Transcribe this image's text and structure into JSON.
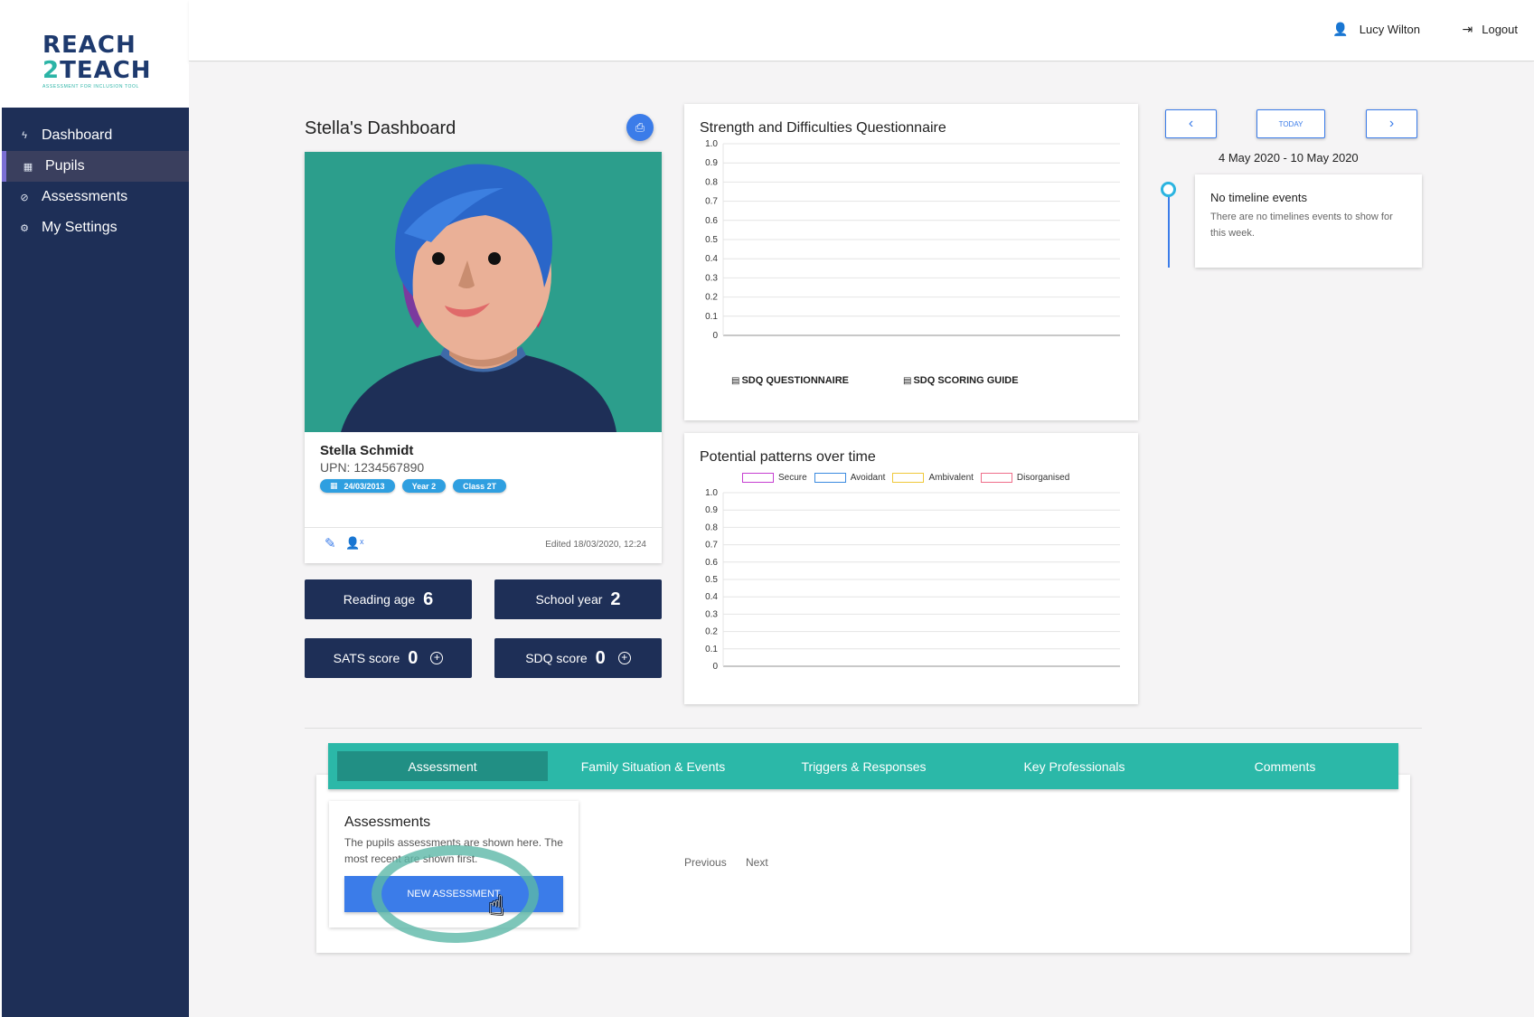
{
  "brand": {
    "line1": "REACH",
    "line2_num": "2",
    "line2_word": "TEACH",
    "tagline": "ASSESSMENT FOR INCLUSION TOOL"
  },
  "sidebar": {
    "items": [
      {
        "label": "Dashboard",
        "icon": "bolt-icon"
      },
      {
        "label": "Pupils",
        "icon": "calendar-icon",
        "active": true
      },
      {
        "label": "Assessments",
        "icon": "compass-icon"
      },
      {
        "label": "My Settings",
        "icon": "gear-icon"
      }
    ]
  },
  "header": {
    "user_name": "Lucy Wilton",
    "logout_label": "Logout"
  },
  "profile": {
    "dashboard_title": "Stella's Dashboard",
    "name": "Stella Schmidt",
    "upn": "UPN: 1234567890",
    "dob": "24/03/2013",
    "year": "Year 2",
    "class": "Class 2T",
    "edited": "Edited 18/03/2020, 12:24"
  },
  "stats": {
    "reading_age_label": "Reading age",
    "reading_age": "6",
    "school_year_label": "School year",
    "school_year": "2",
    "sats_label": "SATS score",
    "sats": "0",
    "sdq_label": "SDQ score",
    "sdq": "0"
  },
  "sdq_card": {
    "title": "Strength and Difficulties Questionnaire",
    "link1": "SDQ QUESTIONNAIRE",
    "link2": "SDQ SCORING GUIDE"
  },
  "patterns_card": {
    "title": "Potential patterns over time"
  },
  "chart_data": [
    {
      "type": "line",
      "yticks": [
        "1.0",
        "0.9",
        "0.8",
        "0.7",
        "0.6",
        "0.5",
        "0.4",
        "0.3",
        "0.2",
        "0.1",
        "0"
      ],
      "ylim": [
        0,
        1
      ],
      "series": []
    },
    {
      "type": "line",
      "yticks": [
        "1.0",
        "0.9",
        "0.8",
        "0.7",
        "0.6",
        "0.5",
        "0.4",
        "0.3",
        "0.2",
        "0.1",
        "0"
      ],
      "ylim": [
        0,
        1
      ],
      "legend": [
        {
          "name": "Secure",
          "color": "#c63fd1"
        },
        {
          "name": "Avoidant",
          "color": "#3b8be0"
        },
        {
          "name": "Ambivalent",
          "color": "#f0c93a"
        },
        {
          "name": "Disorganised",
          "color": "#ef6e8a"
        }
      ],
      "series": []
    }
  ],
  "timeline": {
    "today_label": "TODAY",
    "range": "4 May 2020 - 10 May 2020",
    "empty_title": "No timeline events",
    "empty_text": "There are no timelines events to show for this week."
  },
  "tabs": [
    "Assessment",
    "Family Situation & Events",
    "Triggers & Responses",
    "Key Professionals",
    "Comments"
  ],
  "assessments": {
    "title": "Assessments",
    "desc": "The pupils assessments are shown here. The most recent are shown first.",
    "new_button": "NEW ASSESSMENT",
    "previous": "Previous",
    "next": "Next"
  },
  "colors": {
    "sidebar": "#1e2f57",
    "accent": "#3b7ce9",
    "tabbar": "#2bb8a8"
  }
}
